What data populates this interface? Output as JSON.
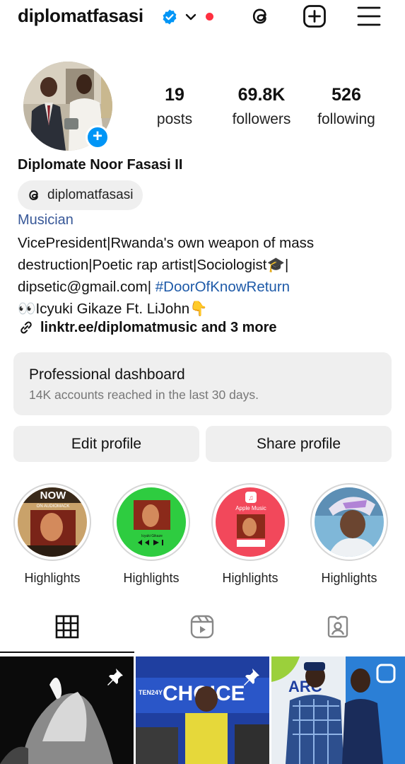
{
  "header": {
    "username": "diplomatfasasi",
    "icons": [
      "verified-badge-icon",
      "chevron-down-icon",
      "threads-icon",
      "create-post-icon",
      "menu-icon"
    ],
    "accent_color": "#0095f6",
    "notification_dot_color": "#ff3040"
  },
  "stats": {
    "posts_count": "19",
    "posts_label": "posts",
    "followers_count": "69.8K",
    "followers_label": "followers",
    "following_count": "526",
    "following_label": "following"
  },
  "profile": {
    "full_name": "Diplomate Noor Fasasi II",
    "threads_handle": "diplomatfasasi",
    "category": "Musician",
    "bio_line1": "VicePresident|Rwanda's own weapon of mass",
    "bio_line2": "destruction|Poetic rap artist|Sociologist🎓|",
    "bio_line3_email": "dipsetic@gmail.com|",
    "bio_line3_hashtag": "#DoorOfKnowReturn",
    "bio_line4": "👀Icyuki Gikaze Ft. LiJohn👇",
    "link_text": "linktr.ee/diplomatmusic and 3 more"
  },
  "dashboard": {
    "title": "Professional dashboard",
    "subtitle": "14K accounts reached in the last 30 days."
  },
  "buttons": {
    "edit_profile": "Edit profile",
    "share_profile": "Share profile"
  },
  "highlights": [
    {
      "label": "Highlights",
      "cover_text": "NOW",
      "cover_subtext": "ON AUDIOMACK"
    },
    {
      "label": "Highlights",
      "cover_text": "Icyuki Gikaze"
    },
    {
      "label": "Highlights",
      "cover_text": "Apple Music"
    },
    {
      "label": "Highlights"
    }
  ],
  "tabs": [
    "grid-tab",
    "reels-tab",
    "tagged-tab"
  ],
  "grid": {
    "tile2_text": "CHOICE",
    "tile2_small": "TEN24Y"
  }
}
